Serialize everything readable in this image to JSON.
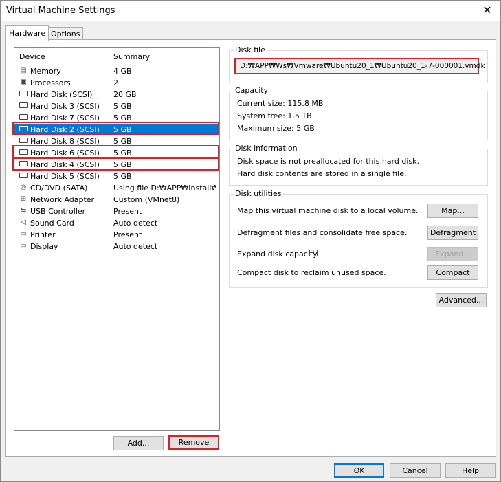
{
  "window": {
    "title": "Virtual Machine Settings",
    "close_glyph": "✕"
  },
  "tabs": [
    {
      "label": "Hardware",
      "active": true
    },
    {
      "label": "Options",
      "active": false
    }
  ],
  "device_list": {
    "columns": {
      "device": "Device",
      "summary": "Summary"
    },
    "rows": [
      {
        "device": "Memory",
        "summary": "4 GB",
        "icon": "memory-icon"
      },
      {
        "device": "Processors",
        "summary": "2",
        "icon": "cpu-icon"
      },
      {
        "device": "Hard Disk (SCSI)",
        "summary": "20 GB",
        "icon": "hard-disk-icon"
      },
      {
        "device": "Hard Disk 3 (SCSI)",
        "summary": "5 GB",
        "icon": "hard-disk-icon"
      },
      {
        "device": "Hard Disk 7 (SCSI)",
        "summary": "5 GB",
        "icon": "hard-disk-icon"
      },
      {
        "device": "Hard Disk 2 (SCSI)",
        "summary": "5 GB",
        "icon": "hard-disk-icon",
        "selected": true
      },
      {
        "device": "Hard Disk 8 (SCSI)",
        "summary": "5 GB",
        "icon": "hard-disk-icon"
      },
      {
        "device": "Hard Disk 6 (SCSI)",
        "summary": "5 GB",
        "icon": "hard-disk-icon"
      },
      {
        "device": "Hard Disk 4 (SCSI)",
        "summary": "5 GB",
        "icon": "hard-disk-icon"
      },
      {
        "device": "Hard Disk 5 (SCSI)",
        "summary": "5 GB",
        "icon": "hard-disk-icon"
      },
      {
        "device": "CD/DVD (SATA)",
        "summary": "Using file D:₩APP₩Install₩O...",
        "icon": "cd-dvd-icon"
      },
      {
        "device": "Network Adapter",
        "summary": "Custom (VMnet8)",
        "icon": "network-icon"
      },
      {
        "device": "USB Controller",
        "summary": "Present",
        "icon": "usb-icon"
      },
      {
        "device": "Sound Card",
        "summary": "Auto detect",
        "icon": "speaker-icon"
      },
      {
        "device": "Printer",
        "summary": "Present",
        "icon": "printer-icon"
      },
      {
        "device": "Display",
        "summary": "Auto detect",
        "icon": "monitor-icon"
      }
    ]
  },
  "list_buttons": {
    "add": "Add...",
    "remove": "Remove"
  },
  "disk_file": {
    "title": "Disk file",
    "path": "D:₩APP₩Ws₩Vmware₩Ubuntu20_1₩Ubuntu20_1-7-000001.vmdk"
  },
  "capacity": {
    "title": "Capacity",
    "current_size": "Current size:  115.8 MB",
    "system_free": "System free:  1.5 TB",
    "maximum_size": "Maximum size:  5 GB"
  },
  "disk_information": {
    "title": "Disk information",
    "line1": "Disk space is not preallocated for this hard disk.",
    "line2": "Hard disk contents are stored in a single file."
  },
  "disk_utilities": {
    "title": "Disk utilities",
    "map_text": "Map this virtual machine disk to a local volume.",
    "map_button": "Map...",
    "defrag_text": "Defragment files and consolidate free space.",
    "defrag_button": "Defragment",
    "expand_text": "Expand disk capacity.",
    "expand_button": "Expand...",
    "compact_text": "Compact disk to reclaim unused space.",
    "compact_button": "Compact"
  },
  "advanced_button": "Advanced...",
  "footer": {
    "ok": "OK",
    "cancel": "Cancel",
    "help": "Help"
  },
  "colors": {
    "selection": "#0078d7",
    "highlight_border": "#d8222a"
  }
}
